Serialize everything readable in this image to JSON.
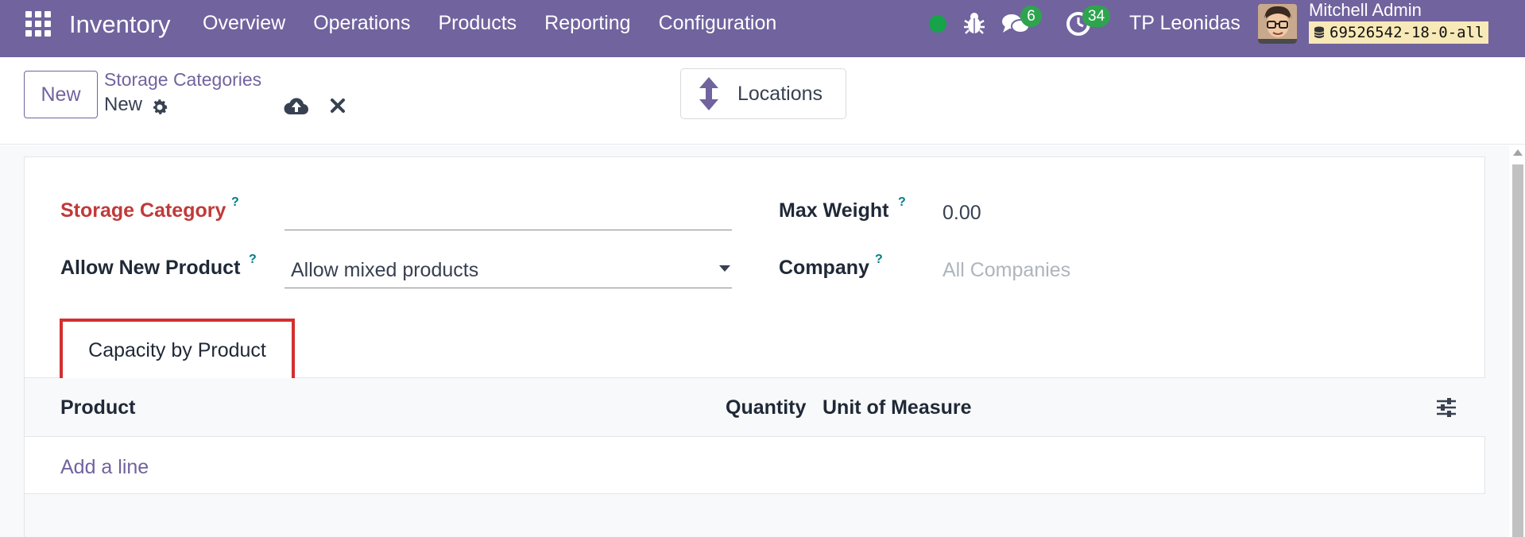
{
  "navbar": {
    "app_name": "Inventory",
    "menu": [
      "Overview",
      "Operations",
      "Products",
      "Reporting",
      "Configuration"
    ],
    "messages_count": "6",
    "activities_count": "34",
    "company": "TP Leonidas",
    "user_name": "Mitchell Admin",
    "database": "69526542-18-0-all"
  },
  "control_panel": {
    "new_button": "New",
    "breadcrumb_parent": "Storage Categories",
    "breadcrumb_current": "New",
    "smart_button_locations": "Locations"
  },
  "form": {
    "storage_category_label": "Storage Category",
    "storage_category_value": "",
    "allow_new_product_label": "Allow New Product",
    "allow_new_product_value": "Allow mixed products",
    "max_weight_label": "Max Weight",
    "max_weight_value": "0.00",
    "company_label": "Company",
    "company_placeholder": "All Companies",
    "help_mark": "?"
  },
  "tab": {
    "label": "Capacity by Product"
  },
  "table": {
    "columns": [
      "Product",
      "Quantity",
      "Unit of Measure"
    ],
    "add_line": "Add a line"
  },
  "colors": {
    "brand": "#71639e",
    "required": "#c03a3a",
    "badge": "#2ea44f",
    "highlight_box": "#d32f2f"
  }
}
